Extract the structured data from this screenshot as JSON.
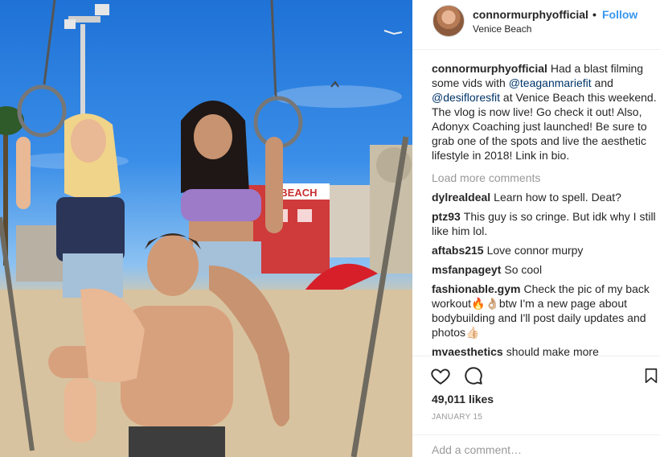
{
  "post": {
    "username": "connormurphyofficial",
    "separator": "•",
    "follow_label": "Follow",
    "location": "Venice Beach",
    "caption": {
      "username": "connormurphyofficial",
      "part1": "Had a blast filming some vids with ",
      "mention1": "@teaganmariefit",
      "part2": " and ",
      "mention2": "@desifloresfit",
      "part3": " at Venice Beach this weekend. The vlog is now live! Go check it out! Also, Adonyx Coaching just launched! Be sure to grab one of the spots and live the aesthetic lifestyle in 2018! Link in bio."
    },
    "load_more_label": "Load more comments",
    "comments": [
      {
        "username": "dylrealdeal",
        "text": "Learn how to spell. Deat?"
      },
      {
        "username": "ptz93",
        "text": "This guy is so cringe. But idk why I still like him lol."
      },
      {
        "username": "aftabs215",
        "text": "Love connor murpy"
      },
      {
        "username": "msfanpageyt",
        "text": "So cool"
      },
      {
        "username": "fashionable.gym",
        "text": "Check the pic of my back workout🔥👌🏼btw I'm a new page about bodybuilding and I'll post daily updates and photos👍🏻"
      },
      {
        "username": "mvaesthetics",
        "text": "should make more"
      }
    ],
    "likes": "49,011 likes",
    "date": "JANUARY 15",
    "add_comment_placeholder": "Add a comment…"
  },
  "photo": {
    "sign_text": "E BEACH"
  },
  "icons": {
    "like": "heart-icon",
    "comment": "comment-icon",
    "save": "bookmark-icon"
  },
  "colors": {
    "follow": "#3897f0",
    "mention": "#003569",
    "muted": "#999999",
    "text": "#262626"
  }
}
